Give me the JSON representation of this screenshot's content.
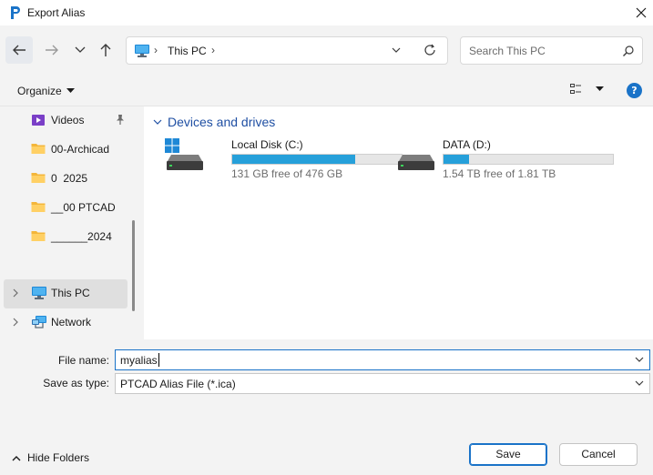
{
  "window": {
    "title": "Export Alias"
  },
  "address": {
    "location": "This PC"
  },
  "search": {
    "placeholder": "Search This PC"
  },
  "toolbar": {
    "organize_label": "Organize"
  },
  "sidebar": {
    "items": [
      {
        "label": "Videos",
        "icon": "videos-icon",
        "pinned": true
      },
      {
        "label": "00-Archicad",
        "icon": "folder-icon"
      },
      {
        "label": "0  2025",
        "icon": "folder-icon"
      },
      {
        "label": "__00 PTCAD",
        "icon": "folder-icon"
      },
      {
        "label": "______2024",
        "icon": "folder-icon"
      },
      {
        "label": "This PC",
        "icon": "computer-icon",
        "selected": true
      },
      {
        "label": "Network",
        "icon": "network-icon"
      }
    ]
  },
  "content": {
    "group_title": "Devices and drives",
    "drives": [
      {
        "name": "Local Disk (C:)",
        "free_text": "131 GB free of 476 GB",
        "used_fraction": 0.725,
        "icon": "windows-drive-icon"
      },
      {
        "name": "DATA (D:)",
        "free_text": "1.54 TB free of 1.81 TB",
        "used_fraction": 0.149,
        "icon": "hard-drive-icon"
      }
    ]
  },
  "form": {
    "file_name_label": "File name:",
    "file_name_value": "myalias",
    "save_type_label": "Save as type:",
    "save_type_value": "PTCAD Alias File (*.ica)"
  },
  "footer": {
    "hide_folders_label": "Hide Folders",
    "save_label": "Save",
    "cancel_label": "Cancel"
  },
  "colors": {
    "accent": "#1a73c8",
    "drive_bar": "#26a0da",
    "group_title": "#1f4fa3"
  }
}
